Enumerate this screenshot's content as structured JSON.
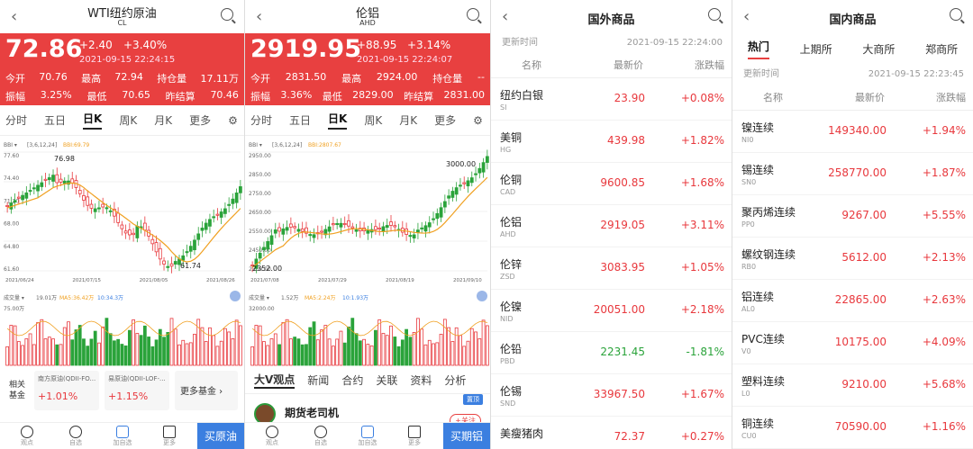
{
  "panel1": {
    "title": "WTI纽约原油",
    "subtitle": "CL",
    "price": "72.86",
    "change": "+2.40",
    "change_pct": "+3.40%",
    "time": "2021-09-15 22:24:15",
    "stats": [
      {
        "l1": "今开",
        "v1": "70.76",
        "l2": "最高",
        "v2": "72.94",
        "l3": "持仓量",
        "v3": "17.11万"
      },
      {
        "l1": "振幅",
        "v1": "3.25%",
        "l2": "最低",
        "v2": "70.65",
        "l3": "昨结算",
        "v3": "70.46"
      }
    ],
    "tabs": [
      "分时",
      "五日",
      "日K",
      "周K",
      "月K",
      "更多"
    ],
    "active_tab": "日K",
    "bbi_label": "BBI",
    "bbi_params": "[3,6,12,24]",
    "bbi_value": "BBI:69.79",
    "y_ticks": [
      "77.60",
      "74.40",
      "71.20",
      "68.00",
      "64.80",
      "61.60"
    ],
    "x_ticks": [
      "2021/06/24",
      "2021/07/15",
      "2021/08/05",
      "2021/08/26"
    ],
    "high_label": "76.98",
    "low_label": "61.74",
    "vol_label": "成交量",
    "vol_value": "19.01万",
    "ma5": "MA5:36.42万",
    "ma10": "10:34.3万",
    "vol_top": "75.00万",
    "fund_label": "相关基金",
    "funds": [
      {
        "name": "南方原油(QDII-FO...",
        "chg": "+1.01%"
      },
      {
        "name": "易原油(QDII-LOF-...",
        "chg": "+1.15%"
      }
    ],
    "more_funds": "更多基金",
    "nav": [
      "观点",
      "自选",
      "加自选",
      "更多"
    ],
    "buy": "买原油"
  },
  "panel2": {
    "title": "伦铝",
    "subtitle": "AHD",
    "price": "2919.95",
    "change": "+88.95",
    "change_pct": "+3.14%",
    "time": "2021-09-15 22:24:07",
    "stats": [
      {
        "l1": "今开",
        "v1": "2831.50",
        "l2": "最高",
        "v2": "2924.00",
        "l3": "持仓量",
        "v3": "--"
      },
      {
        "l1": "振幅",
        "v1": "3.36%",
        "l2": "最低",
        "v2": "2829.00",
        "l3": "昨结算",
        "v3": "2831.00"
      }
    ],
    "tabs": [
      "分时",
      "五日",
      "日K",
      "周K",
      "月K",
      "更多"
    ],
    "active_tab": "日K",
    "bbi_label": "BBI",
    "bbi_params": "[3,6,12,24]",
    "bbi_value": "BBI:2807.67",
    "y_ticks": [
      "2950.00",
      "2850.00",
      "2750.00",
      "2650.00",
      "2550.00",
      "2450.00",
      "2350.00"
    ],
    "x_ticks": [
      "2021/07/08",
      "2021/07/29",
      "2021/08/19",
      "2021/09/10"
    ],
    "high_label": "3000.00",
    "low_label": "2352.00",
    "vol_label": "成交量",
    "vol_value": "1.52万",
    "ma5": "MA5:2.24万",
    "ma10": "10:1.93万",
    "vol_top": "32000.00",
    "news_tabs": [
      "大V观点",
      "新闻",
      "合约",
      "关联",
      "资料",
      "分析"
    ],
    "badge": "置顶",
    "author": "期货老司机",
    "follow": "+关注",
    "nav": [
      "观点",
      "自选",
      "加自选",
      "更多"
    ],
    "buy": "买期铝"
  },
  "panel3": {
    "title": "国外商品",
    "update_label": "更新时间",
    "update_time": "2021-09-15 22:24:00",
    "cols": [
      "名称",
      "最新价",
      "涨跌幅"
    ],
    "rows": [
      {
        "name": "纽约白银",
        "code": "SI",
        "price": "23.90",
        "chg": "+0.08%",
        "dir": "up"
      },
      {
        "name": "美铜",
        "code": "HG",
        "price": "439.98",
        "chg": "+1.82%",
        "dir": "up"
      },
      {
        "name": "伦铜",
        "code": "CAD",
        "price": "9600.85",
        "chg": "+1.68%",
        "dir": "up"
      },
      {
        "name": "伦铝",
        "code": "AHD",
        "price": "2919.05",
        "chg": "+3.11%",
        "dir": "up"
      },
      {
        "name": "伦锌",
        "code": "ZSD",
        "price": "3083.95",
        "chg": "+1.05%",
        "dir": "up"
      },
      {
        "name": "伦镍",
        "code": "NID",
        "price": "20051.00",
        "chg": "+2.18%",
        "dir": "up"
      },
      {
        "name": "伦铅",
        "code": "PBD",
        "price": "2231.45",
        "chg": "-1.81%",
        "dir": "dn"
      },
      {
        "name": "伦锡",
        "code": "SND",
        "price": "33967.50",
        "chg": "+1.67%",
        "dir": "up"
      },
      {
        "name": "美瘦猪肉",
        "code": "",
        "price": "72.37",
        "chg": "+0.27%",
        "dir": "up"
      }
    ]
  },
  "panel4": {
    "title": "国内商品",
    "tabs": [
      "热门",
      "上期所",
      "大商所",
      "郑商所"
    ],
    "active_tab": "热门",
    "update_label": "更新时间",
    "update_time": "2021-09-15 22:23:45",
    "cols": [
      "名称",
      "最新价",
      "涨跌幅"
    ],
    "rows": [
      {
        "name": "镍连续",
        "code": "NI0",
        "price": "149340.00",
        "chg": "+1.94%",
        "dir": "up"
      },
      {
        "name": "锡连续",
        "code": "SN0",
        "price": "258770.00",
        "chg": "+1.87%",
        "dir": "up"
      },
      {
        "name": "聚丙烯连续",
        "code": "PP0",
        "price": "9267.00",
        "chg": "+5.55%",
        "dir": "up"
      },
      {
        "name": "螺纹钢连续",
        "code": "RB0",
        "price": "5612.00",
        "chg": "+2.13%",
        "dir": "up"
      },
      {
        "name": "铝连续",
        "code": "AL0",
        "price": "22865.00",
        "chg": "+2.63%",
        "dir": "up"
      },
      {
        "name": "PVC连续",
        "code": "V0",
        "price": "10175.00",
        "chg": "+4.09%",
        "dir": "up"
      },
      {
        "name": "塑料连续",
        "code": "L0",
        "price": "9210.00",
        "chg": "+5.68%",
        "dir": "up"
      },
      {
        "name": "铜连续",
        "code": "CU0",
        "price": "70590.00",
        "chg": "+1.16%",
        "dir": "up"
      }
    ]
  },
  "colors": {
    "up": "#e8383d",
    "down": "#2aa33a",
    "quote_bg": "#e84040",
    "accent_blue": "#3b7fe0",
    "ma_orange": "#f0a020"
  }
}
